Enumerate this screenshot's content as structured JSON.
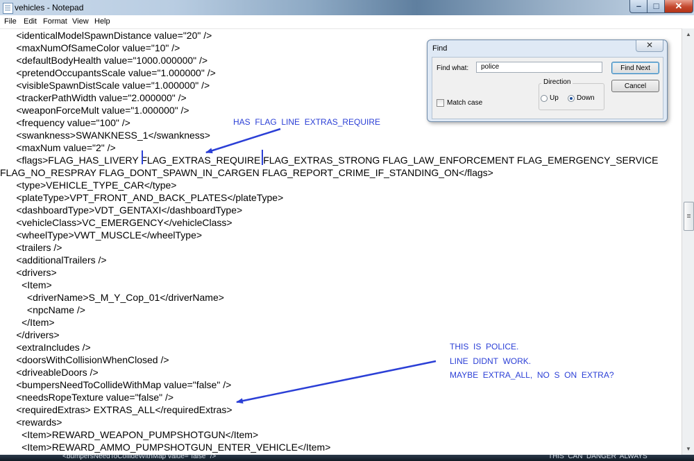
{
  "window": {
    "title": "vehicles - Notepad",
    "minimize_glyph": "–",
    "maximize_glyph": "□",
    "close_glyph": "✕"
  },
  "menu": [
    "File",
    "Edit",
    "Format",
    "View",
    "Help"
  ],
  "editor_lines": [
    "      <identicalModelSpawnDistance value=\"20\" />",
    "      <maxNumOfSameColor value=\"10\" />",
    "      <defaultBodyHealth value=\"1000.000000\" />",
    "      <pretendOccupantsScale value=\"1.000000\" />",
    "      <visibleSpawnDistScale value=\"1.000000\" />",
    "      <trackerPathWidth value=\"2.000000\" />",
    "      <weaponForceMult value=\"1.000000\" />",
    "      <frequency value=\"100\" />",
    "      <swankness>SWANKNESS_1</swankness>",
    "      <maxNum value=\"2\" />",
    "      <flags>FLAG_HAS_LIVERY FLAG_EXTRAS_REQUIRE FLAG_EXTRAS_STRONG FLAG_LAW_ENFORCEMENT FLAG_EMERGENCY_SERVICE",
    "FLAG_NO_RESPRAY FLAG_DONT_SPAWN_IN_CARGEN FLAG_REPORT_CRIME_IF_STANDING_ON</flags>",
    "      <type>VEHICLE_TYPE_CAR</type>",
    "      <plateType>VPT_FRONT_AND_BACK_PLATES</plateType>",
    "      <dashboardType>VDT_GENTAXI</dashboardType>",
    "      <vehicleClass>VC_EMERGENCY</vehicleClass>",
    "      <wheelType>VWT_MUSCLE</wheelType>",
    "      <trailers />",
    "      <additionalTrailers />",
    "      <drivers>",
    "        <Item>",
    "          <driverName>S_M_Y_Cop_01</driverName>",
    "          <npcName />",
    "        </Item>",
    "      </drivers>",
    "      <extraIncludes />",
    "      <doorsWithCollisionWhenClosed />",
    "      <driveableDoors />",
    "      <bumpersNeedToCollideWithMap value=\"false\" />",
    "      <needsRopeTexture value=\"false\" />",
    "      <requiredExtras> EXTRAS_ALL</requiredExtras>",
    "      <rewards>",
    "        <Item>REWARD_WEAPON_PUMPSHOTGUN</Item>",
    "        <Item>REWARD_AMMO_PUMPSHOTGUN_ENTER_VEHICLE</Item>"
  ],
  "find_dialog": {
    "title": "Find",
    "close_glyph": "✕",
    "find_what_label": "Find what:",
    "find_what_value": "police",
    "find_next_label": "Find Next",
    "cancel_label": "Cancel",
    "direction_label": "Direction",
    "up_label": "Up",
    "down_label": "Down",
    "direction_selected": "Down",
    "match_case_label": "Match case",
    "match_case_checked": false
  },
  "annotations": {
    "top": "HAS  FLAG  LINE  EXTRAS_REQUIRE",
    "bottom_lines": [
      "THIS  IS  POLICE.",
      "LINE  DIDNT  WORK.",
      "MAYBE  EXTRA_ALL,  NO  S  ON  EXTRA?"
    ],
    "color": "#2b3fd6"
  },
  "taskbar": {
    "left_text": "<bumpersNeedToCollideWithMap value=\"false\" />",
    "right_text": "THIS  CAN  DANGER  ALWAYS"
  }
}
